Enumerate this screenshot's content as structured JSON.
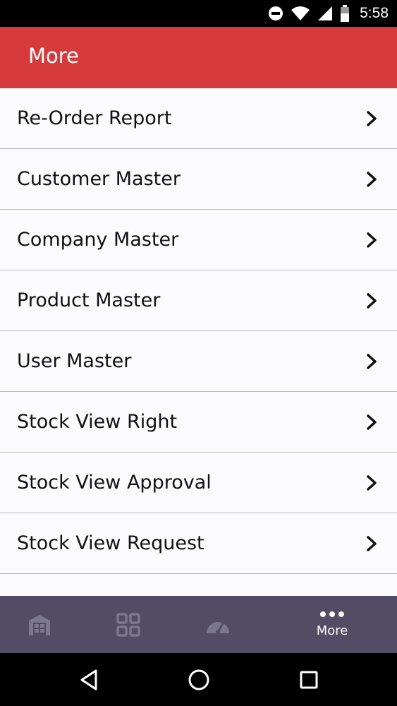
{
  "status_bar": {
    "time": "5:58",
    "icons": [
      "do-not-disturb-icon",
      "wifi-icon",
      "signal-icon",
      "battery-icon"
    ]
  },
  "app_bar": {
    "title": "More"
  },
  "menu": {
    "items": [
      {
        "label": "Re-Order Report"
      },
      {
        "label": "Customer Master"
      },
      {
        "label": "Company Master"
      },
      {
        "label": "Product Master"
      },
      {
        "label": "User Master"
      },
      {
        "label": "Stock View Right"
      },
      {
        "label": "Stock View Approval"
      },
      {
        "label": "Stock View Request"
      }
    ],
    "chevron_icon": "chevron-right-icon"
  },
  "bottom_nav": {
    "tabs": [
      {
        "icon": "warehouse-icon",
        "label": ""
      },
      {
        "icon": "grid-icon",
        "label": ""
      },
      {
        "icon": "dashboard-gauge-icon",
        "label": ""
      },
      {
        "icon": "more-dots-icon",
        "label": "More",
        "active": true
      }
    ]
  },
  "system_nav": {
    "buttons": [
      "back-icon",
      "home-icon",
      "recents-icon"
    ]
  },
  "colors": {
    "app_bar": "#d63a3b",
    "bottom_nav": "#524d65",
    "inactive_icon": "#7c7790",
    "background": "#fbfafc"
  }
}
